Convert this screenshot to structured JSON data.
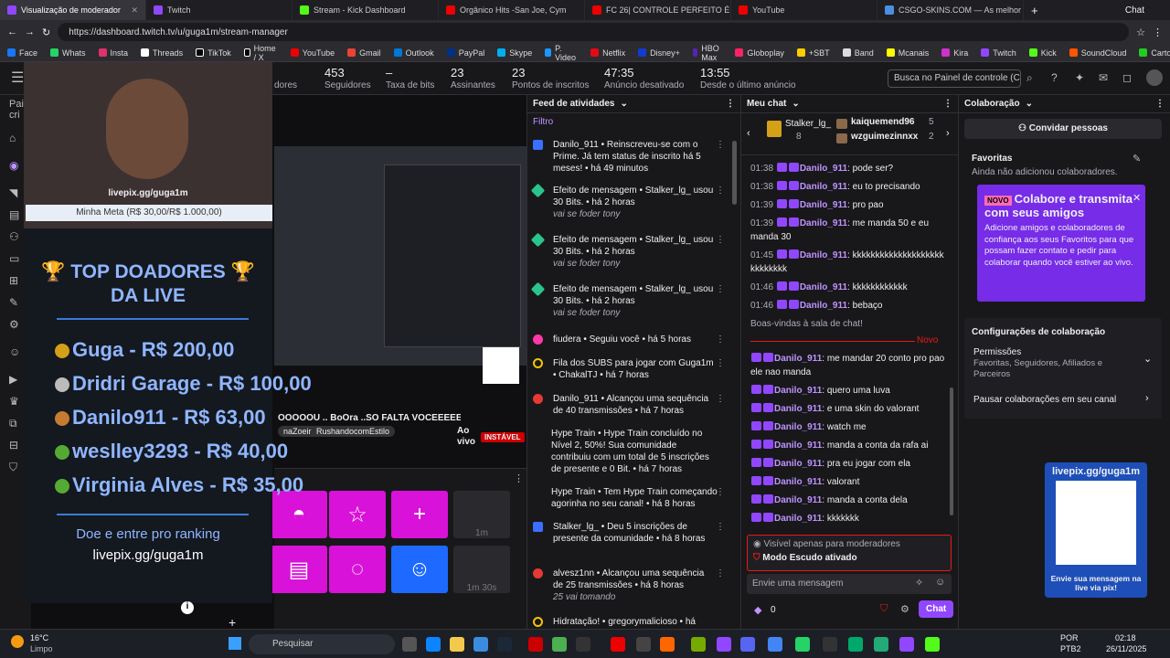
{
  "tabs": [
    {
      "title": "Visualização de moderador"
    },
    {
      "title": "Twitch"
    },
    {
      "title": "Stream - Kick Dashboard"
    },
    {
      "title": "Orgânico Hits -San Joe, Cym"
    },
    {
      "title": "FC 26| CONTROLE PERFEITO É P"
    },
    {
      "title": "YouTube"
    },
    {
      "title": "CSGO-SKINS.COM — As melhor"
    }
  ],
  "tab_plus": "+",
  "chat_btn": "Chat",
  "url": "https://dashboard.twitch.tv/u/guga1m/stream-manager",
  "bookmarks": [
    "Face",
    "Whats",
    "Insta",
    "Threads",
    "TikTok",
    "Home / X",
    "YouTube",
    "Gmail",
    "Outlook",
    "PayPal",
    "Skype",
    "P. Video",
    "Netflix",
    "Disney+",
    "HBO Max",
    "Globoplay",
    "+SBT",
    "Band",
    "Mcanais",
    "Kira",
    "Twitch",
    "Kick",
    "SoundCloud",
    "Cartola"
  ],
  "stats": [
    {
      "value": "",
      "label": "dores"
    },
    {
      "value": "453",
      "label": "Seguidores"
    },
    {
      "value": "–",
      "label": "Taxa de bits"
    },
    {
      "value": "23",
      "label": "Assinantes"
    },
    {
      "value": "23",
      "label": "Pontos de inscritos"
    },
    {
      "value": "47:35",
      "label": "Anúncio desativado"
    },
    {
      "value": "13:55",
      "label": "Desde o último anúncio"
    }
  ],
  "search_placeholder": "Busca no Painel de controle (C",
  "cam": {
    "name": "livepix.gg/guga1m",
    "goal": "Minha Meta (R$ 30,00/R$ 1.000,00)"
  },
  "overlay": {
    "title": "🏆 TOP DOADORES 🏆",
    "subtitle": "DA LIVE",
    "donors": [
      "Guga - R$ 200,00",
      "Dridri Garage - R$ 100,00",
      "Danilo911 - R$ 63,00",
      "weslley3293 - R$ 40,00",
      "Virginia Alves - R$ 35,00"
    ],
    "cta": "Doe e entre pro ranking",
    "link": "livepix.gg/guga1m"
  },
  "left_label": "Pai cri",
  "video": {
    "caption": "OOOOOU .. BoOra ..SO FALTA VOCEEEEEE",
    "tags": [
      "naZoeira",
      "RushandocomEstilo"
    ],
    "live": "Ao vivo",
    "unstable": "INSTÁVEL"
  },
  "quick": {
    "timer1": "1m",
    "timer2": "1m 30s"
  },
  "feed": {
    "title": "Feed de atividades",
    "filter": "Filtro",
    "items": [
      {
        "text": "Danilo_911 • Reinscreveu-se com o Prime. Já tem status de inscrito há 5 meses! • há 49 minutos",
        "sub": ""
      },
      {
        "text": "Efeito de mensagem • Stalker_lg_ usou 30 Bits. • há 2 horas",
        "sub": "vai se foder tony"
      },
      {
        "text": "Efeito de mensagem • Stalker_lg_ usou 30 Bits. • há 2 horas",
        "sub": "vai se foder tony"
      },
      {
        "text": "Efeito de mensagem • Stalker_lg_ usou 30 Bits. • há 2 horas",
        "sub": "vai se foder tony"
      },
      {
        "text": "fiudera • Seguiu você • há 5 horas",
        "sub": ""
      },
      {
        "text": "Fila dos SUBS para jogar com Guga1m • ChakalTJ • há 7 horas",
        "sub": ""
      },
      {
        "text": "Danilo_911 • Alcançou uma sequência de 40 transmissões • há 7 horas",
        "sub": ""
      },
      {
        "text": "Hype Train • Hype Train concluído no Nível 2, 50%! Sua comunidade contribuiu com um total de 5 inscrições de presente e 0 Bit. • há 7 horas",
        "sub": ""
      },
      {
        "text": "Hype Train • Tem Hype Train começando agorinha no seu canal! • há 8 horas",
        "sub": ""
      },
      {
        "text": "Stalker_lg_ • Deu 5 inscrições de presente da comunidade • há 8 horas",
        "sub": ""
      },
      {
        "text": "alvesz1nn • Alcançou uma sequência de 25 transmissões • há 8 horas",
        "sub": "25 vai tomando"
      },
      {
        "text": "Hidratação! • gregorymalicioso • há",
        "sub": ""
      }
    ]
  },
  "chat": {
    "title": "Meu chat",
    "top": [
      {
        "name": "Stalker_lg_",
        "count": "8"
      },
      {
        "name": "kaiquemend96",
        "count": "5"
      },
      {
        "name": "wzguimezinnxx",
        "count": "2"
      }
    ],
    "messages": [
      {
        "time": "01:38",
        "user": "Danilo_911",
        "text": ": pode ser?"
      },
      {
        "time": "01:38",
        "user": "Danilo_911",
        "text": ": eu to precisando"
      },
      {
        "time": "01:39",
        "user": "Danilo_911",
        "text": ": pro pao"
      },
      {
        "time": "01:39",
        "user": "Danilo_911",
        "text": ": me manda 50 e eu manda 30"
      },
      {
        "time": "01:45",
        "user": "Danilo_911",
        "text": ": kkkkkkkkkkkkkkkkkkkkkkkkkkkk"
      },
      {
        "time": "01:46",
        "user": "Danilo_911",
        "text": ": kkkkkkkkkkkk"
      },
      {
        "time": "01:46",
        "user": "Danilo_911",
        "text": ": bebaço"
      }
    ],
    "welcome": "Boas-vindas à sala de chat!",
    "new": "Novo",
    "new_messages": [
      {
        "user": "Danilo_911",
        "text": ": me mandar 20 conto pro pao ele nao manda"
      },
      {
        "user": "Danilo_911",
        "text": ": quero uma luva"
      },
      {
        "user": "Danilo_911",
        "text": ": e uma skin do valorant"
      },
      {
        "user": "Danilo_911",
        "text": ": watch me"
      },
      {
        "user": "Danilo_911",
        "text": ": manda a conta da rafa ai"
      },
      {
        "user": "Danilo_911",
        "text": ": pra eu jogar com ela"
      },
      {
        "user": "Danilo_911",
        "text": ": valorant"
      },
      {
        "user": "Danilo_911",
        "text": ": manda a conta dela"
      },
      {
        "user": "Danilo_911",
        "text": ": kkkkkkk"
      }
    ],
    "mod_only": "Visível apenas para moderadores",
    "shield": "Modo Escudo ativado",
    "placeholder": "Envie uma mensagem",
    "points": "0",
    "send": "Chat"
  },
  "colab": {
    "title": "Colaboração",
    "invite": "Convidar pessoas",
    "fav_title": "Favoritas",
    "fav_empty": "Ainda não adicionou colaboradores.",
    "promo_badge": "NOVO",
    "promo_title": "Colabore e transmita com seus amigos",
    "promo_text": "Adicione amigos e colaboradores de confiança aos seus Favoritos para que possam fazer contato e pedir para colaborar quando você estiver ao vivo.",
    "settings": "Configurações de colaboração",
    "perm": "Permissões",
    "perm_sub": "Favoritas, Seguidores, Afiliados e Parceiros",
    "pause": "Pausar colaborações em seu canal",
    "qr_top": "livepix.gg/guga1m",
    "qr_bottom": "Envie sua mensagem na live via pix!"
  },
  "taskbar": {
    "weather": "16°C",
    "weather_sub": "Limpo",
    "search": "Pesquisar",
    "lang": "POR",
    "lang_sub": "PTB2",
    "time": "02:18",
    "date": "26/11/2025"
  }
}
